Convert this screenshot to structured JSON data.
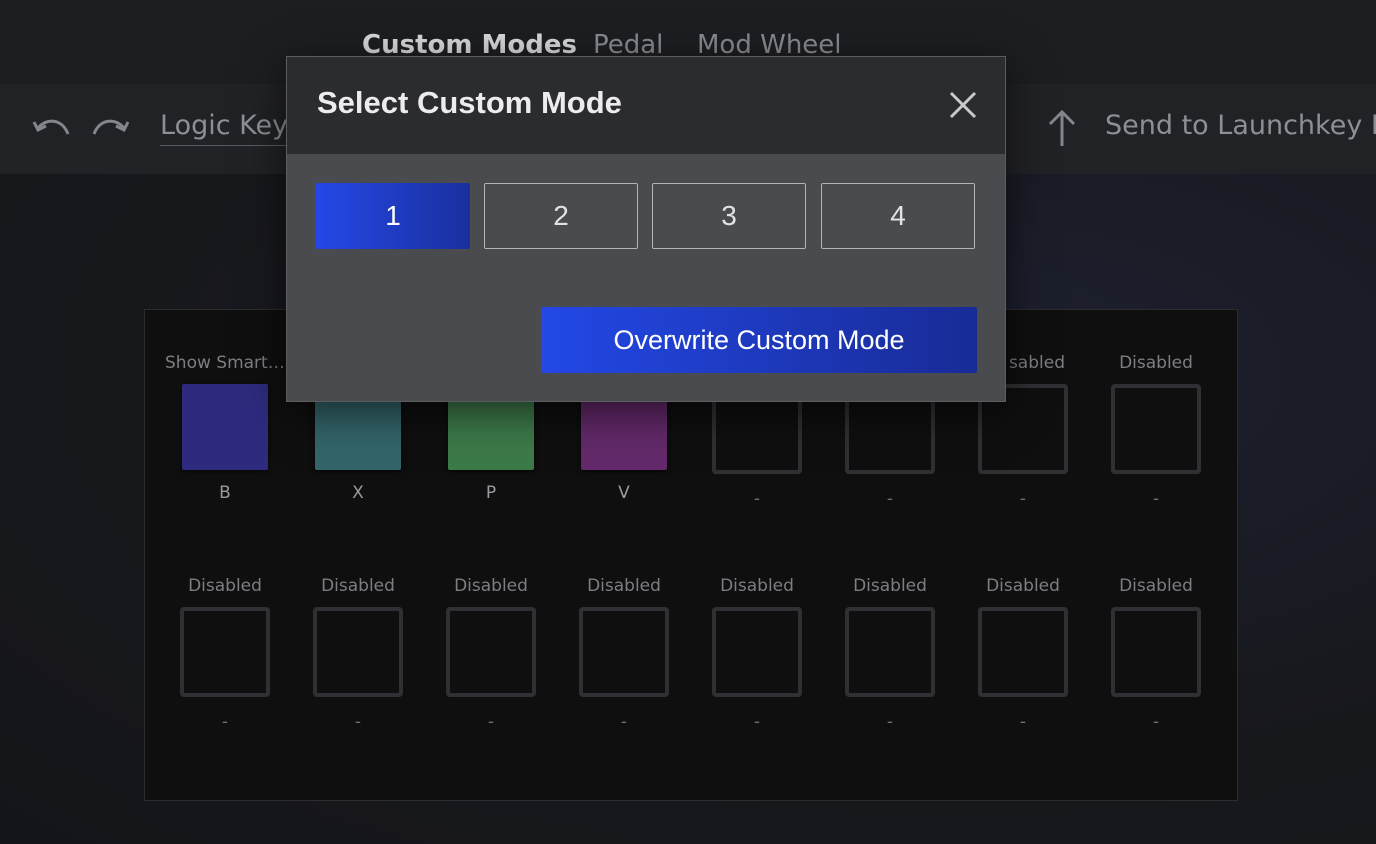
{
  "nav": {
    "tabs": [
      {
        "label": "Custom Modes",
        "active": true
      },
      {
        "label": "Pedal",
        "active": false
      },
      {
        "label": "Mod Wheel",
        "active": false
      }
    ]
  },
  "toolbar": {
    "undo_icon": "undo-icon",
    "redo_icon": "redo-icon",
    "template_name": "Logic Keys",
    "send_icon": "upload-arrow-icon",
    "send_label": "Send to Launchkey M"
  },
  "pads": {
    "row1": [
      {
        "top": "Show Smart ...",
        "color": "#2e2b7e",
        "bottom": "B"
      },
      {
        "top": "",
        "color": "#33656a",
        "bottom": "X"
      },
      {
        "top": "",
        "color": "#3d7a4a",
        "bottom": "P"
      },
      {
        "top": "",
        "color": "#63296a",
        "bottom": "V"
      },
      {
        "top": "",
        "color": null,
        "bottom": "-"
      },
      {
        "top": "",
        "color": null,
        "bottom": "-"
      },
      {
        "top": "sabled",
        "color": null,
        "bottom": "-"
      },
      {
        "top": "Disabled",
        "color": null,
        "bottom": "-"
      }
    ],
    "row2": [
      {
        "top": "Disabled",
        "bottom": "-"
      },
      {
        "top": "Disabled",
        "bottom": "-"
      },
      {
        "top": "Disabled",
        "bottom": "-"
      },
      {
        "top": "Disabled",
        "bottom": "-"
      },
      {
        "top": "Disabled",
        "bottom": "-"
      },
      {
        "top": "Disabled",
        "bottom": "-"
      },
      {
        "top": "Disabled",
        "bottom": "-"
      },
      {
        "top": "Disabled",
        "bottom": "-"
      }
    ]
  },
  "modal": {
    "title": "Select Custom Mode",
    "close_icon": "close-icon",
    "modes": [
      "1",
      "2",
      "3",
      "4"
    ],
    "selected_mode": "1",
    "confirm_label": "Overwrite Custom Mode"
  },
  "colors": {
    "accent_blue": "#2348e6",
    "accent_blue_dark": "#1b2f9e"
  }
}
